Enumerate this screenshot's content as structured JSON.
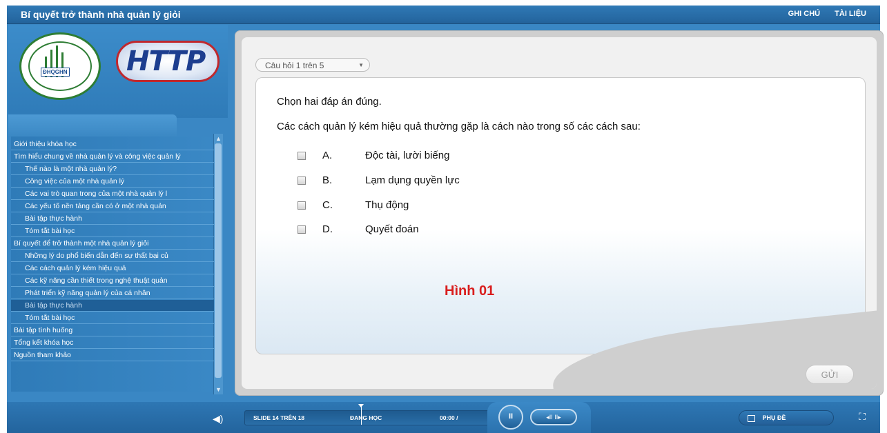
{
  "app": {
    "title": "Bí quyết trở thành nhà quản lý giỏi",
    "links": {
      "notes": "GHI CHÚ",
      "resources": "TÀI LIỆU"
    }
  },
  "logo": {
    "text": "HTTP",
    "badge": "ĐHQGHN"
  },
  "outline": {
    "items": [
      {
        "label": "Giới thiệu khóa học",
        "level": 0
      },
      {
        "label": "Tìm hiểu chung về nhà quản lý và công việc quản lý",
        "level": 0
      },
      {
        "label": "Thế nào là một nhà quản lý?",
        "level": 1
      },
      {
        "label": "Công việc của một nhà quản lý",
        "level": 1
      },
      {
        "label": "Các vai trò quan trong của một nhà quản lý l",
        "level": 1
      },
      {
        "label": "Các yếu tố nền tảng cần có ở một nhà quản",
        "level": 1
      },
      {
        "label": "Bài tập thực hành",
        "level": 1
      },
      {
        "label": "Tóm tắt bài học",
        "level": 1
      },
      {
        "label": "Bí quyết để trở thành một nhà quản lý giỏi",
        "level": 0
      },
      {
        "label": "Những lý do phổ biến dẫn đến sự thất bại củ",
        "level": 1
      },
      {
        "label": "Các cách quản lý kém hiệu quả",
        "level": 1
      },
      {
        "label": "Các kỹ năng cần thiết trong nghệ thuật quản",
        "level": 1
      },
      {
        "label": "Phát triển kỹ năng quản lý của cá nhân",
        "level": 1
      },
      {
        "label": "Bài tập thực hành",
        "level": 1,
        "selected": true
      },
      {
        "label": "Tóm tắt bài học",
        "level": 1
      },
      {
        "label": "Bài tập tình huống",
        "level": 0
      },
      {
        "label": "Tổng kết khóa học",
        "level": 0
      },
      {
        "label": "Nguồn tham khảo",
        "level": 0
      }
    ]
  },
  "quiz": {
    "question_selector": "Câu hỏi 1 trên 5",
    "instruction": "Chọn hai đáp án đúng.",
    "question": "Các cách quản lý kém hiệu quả thường gặp là cách nào trong số các cách sau:",
    "options": [
      {
        "letter": "A.",
        "text": "Độc tài, lười biếng"
      },
      {
        "letter": "B.",
        "text": "Lạm dụng quyền lực"
      },
      {
        "letter": "C.",
        "text": "Thụ động"
      },
      {
        "letter": "D.",
        "text": "Quyết đoán"
      }
    ],
    "figure_label": "Hình 01",
    "submit_label": "GỬI"
  },
  "player": {
    "slide_status": "SLIDE 14 TRÊN 18",
    "state": "ĐANG HỌC",
    "time": "00:00 /",
    "play_symbol": "II",
    "step_symbols": "◂II II▸",
    "subtitles_label": "PHỤ ĐỀ",
    "volume_icon": "speaker-icon",
    "fullscreen_icon": "fullscreen-icon"
  }
}
